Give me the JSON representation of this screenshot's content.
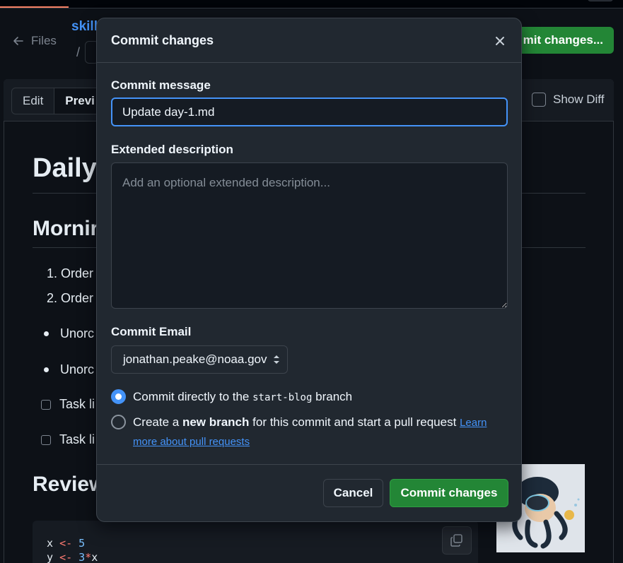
{
  "background": {
    "files_label": "Files",
    "repo_fragment": "skill",
    "path_separator": "/",
    "header_commit_button": "mit changes...",
    "tabs": {
      "edit": "Edit",
      "preview": "Previ"
    },
    "show_diff_label": "Show Diff",
    "preview": {
      "h1": "Daily",
      "h2_morning": "Mornir",
      "ordered": [
        "1. Order",
        "2. Order"
      ],
      "unordered": [
        "Unorc",
        "Unorc"
      ],
      "tasks": [
        "Task li",
        "Task li"
      ],
      "h2_review": "Review",
      "code": {
        "line1": {
          "var": "x",
          "op": "<-",
          "num": "5"
        },
        "line2": {
          "var": "y",
          "op": "<-",
          "num": "3",
          "op2": "*",
          "tail": "x"
        }
      }
    }
  },
  "modal": {
    "title": "Commit changes",
    "commit_message_label": "Commit message",
    "commit_message_value": "Update day-1.md",
    "extended_description_label": "Extended description",
    "extended_description_placeholder": "Add an optional extended description...",
    "commit_email_label": "Commit Email",
    "commit_email_value": "jonathan.peake@noaa.gov",
    "option_direct": {
      "prefix": "Commit directly to the",
      "branch": "start-blog",
      "suffix": "branch"
    },
    "option_new_branch": {
      "prefix": "Create a",
      "bold": "new branch",
      "suffix": "for this commit and start a pull request",
      "link": "Learn more about pull requests"
    },
    "cancel_label": "Cancel",
    "commit_label": "Commit changes"
  }
}
